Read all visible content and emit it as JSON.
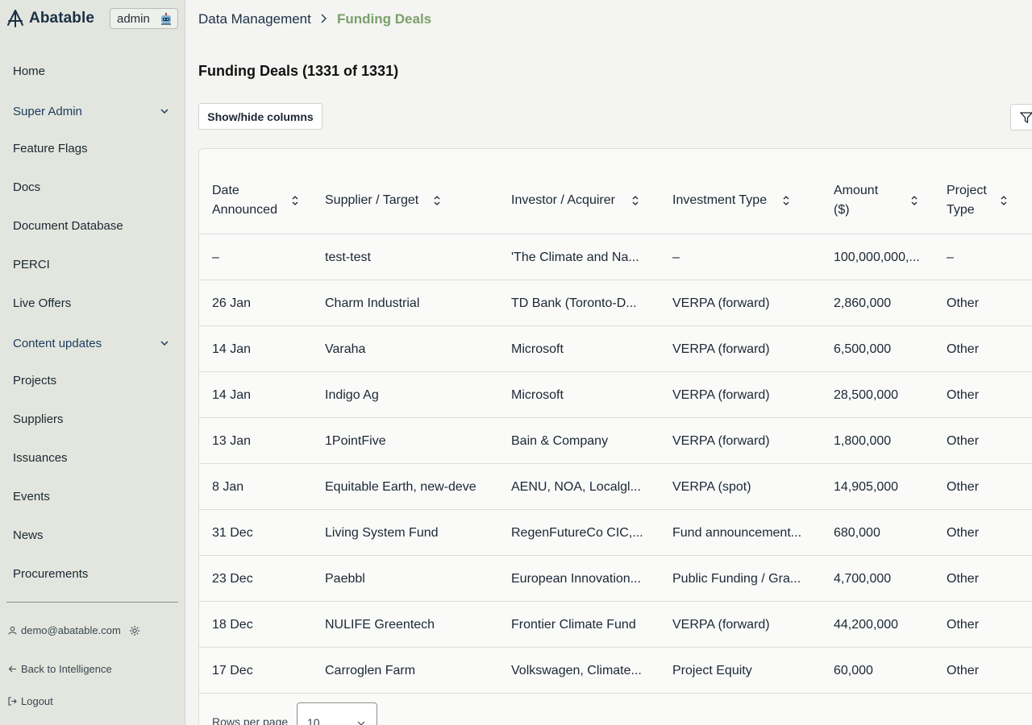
{
  "sidebar": {
    "brand": "Abatable",
    "admin_badge": "admin",
    "items": [
      {
        "label": "Home"
      },
      {
        "label": "Super Admin"
      },
      {
        "label": "Feature Flags"
      },
      {
        "label": "Docs"
      },
      {
        "label": "Document Database"
      },
      {
        "label": "PERCI"
      },
      {
        "label": "Live Offers"
      },
      {
        "label": "Content updates"
      },
      {
        "label": "Projects"
      },
      {
        "label": "Suppliers"
      },
      {
        "label": "Issuances"
      },
      {
        "label": "Events"
      },
      {
        "label": "News"
      },
      {
        "label": "Procurements"
      }
    ],
    "user_email": "demo@abatable.com",
    "back_link": "Back to Intelligence",
    "logout": "Logout"
  },
  "breadcrumb": {
    "parent": "Data Management",
    "current": "Funding Deals"
  },
  "main": {
    "title": "Funding Deals (1331 of 1331)",
    "show_hide_columns": "Show/hide columns"
  },
  "table": {
    "headers": [
      {
        "line1": "Date",
        "line2": "Announced"
      },
      {
        "line1": "Supplier / Target",
        "line2": ""
      },
      {
        "line1": "Investor / Acquirer",
        "line2": ""
      },
      {
        "line1": "Investment Type",
        "line2": ""
      },
      {
        "line1": "Amount",
        "line2": "($)"
      },
      {
        "line1": "Project",
        "line2": "Type"
      }
    ],
    "rows": [
      [
        "–",
        "test-test",
        "'The Climate and Na...",
        "–",
        "100,000,000,...",
        "–"
      ],
      [
        "26 Jan",
        "Charm Industrial",
        "TD Bank (Toronto-D...",
        "VERPA (forward)",
        "2,860,000",
        "Other"
      ],
      [
        "14 Jan",
        "Varaha",
        "Microsoft",
        "VERPA (forward)",
        "6,500,000",
        "Other"
      ],
      [
        "14 Jan",
        "Indigo Ag",
        "Microsoft",
        "VERPA (forward)",
        "28,500,000",
        "Other"
      ],
      [
        "13 Jan",
        "1PointFive",
        "Bain & Company",
        "VERPA (forward)",
        "1,800,000",
        "Other"
      ],
      [
        "8 Jan",
        "Equitable Earth, new-deve",
        "AENU, NOA, Localgl...",
        "VERPA (spot)",
        "14,905,000",
        "Other"
      ],
      [
        "31 Dec",
        "Living System Fund",
        "RegenFutureCo CIC,...",
        "Fund announcement...",
        "680,000",
        "Other"
      ],
      [
        "23 Dec",
        "Paebbl",
        "European Innovation...",
        "Public Funding / Gra...",
        "4,700,000",
        "Other"
      ],
      [
        "18 Dec",
        "NULIFE Greentech",
        "Frontier Climate Fund",
        "VERPA (forward)",
        "44,200,000",
        "Other"
      ],
      [
        "17 Dec",
        "Carroglen Farm",
        "Volkswagen, Climate...",
        "Project Equity",
        "60,000",
        "Other"
      ]
    ]
  },
  "pagination": {
    "rows_per_page_label": "Rows per page",
    "rows_per_page_value": "10"
  },
  "colors": {
    "sidebar_bg": "#e2e6de",
    "page_bg": "#f4f4f2",
    "brand": "#1b3046",
    "breadcrumb_active": "#7aa06a"
  }
}
